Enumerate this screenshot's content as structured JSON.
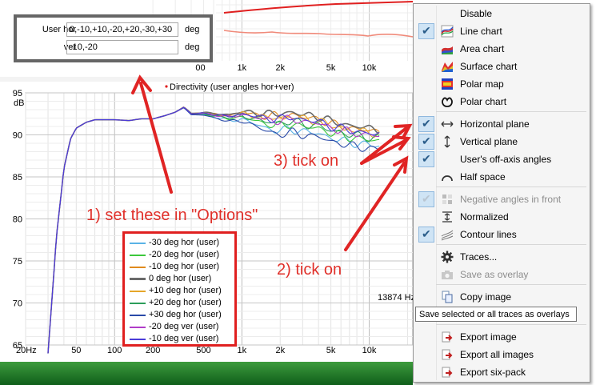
{
  "chart": {
    "title": "Directivity (user angles hor+ver)",
    "y_unit": "dB",
    "marker_readout": "13874 Hz"
  },
  "options_panel": {
    "rows": [
      {
        "label": "User hor",
        "value": "0,-10,+10,-20,+20,-30,+30",
        "unit": "deg"
      },
      {
        "label": "ver",
        "value": "-10,-20",
        "unit": "deg"
      }
    ]
  },
  "legend": [
    {
      "label": "-30 deg hor (user)",
      "color": "#5ab3e6"
    },
    {
      "label": "-20 deg hor (user)",
      "color": "#3cc83c"
    },
    {
      "label": "-10 deg hor (user)",
      "color": "#e08a1e"
    },
    {
      "label": "0 deg hor (user)",
      "color": "#6a6a6a"
    },
    {
      "label": "+10 deg hor (user)",
      "color": "#e6a62a"
    },
    {
      "label": "+20 deg hor (user)",
      "color": "#2c9e5a"
    },
    {
      "label": "+30 deg hor (user)",
      "color": "#2a4aa8"
    },
    {
      "label": "-20 deg ver (user)",
      "color": "#b03cc8"
    },
    {
      "label": "-10 deg ver (user)",
      "color": "#4a3cd8"
    }
  ],
  "menu": {
    "items": [
      {
        "label": "Disable",
        "checked": false,
        "icon": "blank-icon",
        "disabled": false
      },
      {
        "label": "Line chart",
        "checked": true,
        "icon": "line-chart-icon",
        "disabled": false
      },
      {
        "label": "Area chart",
        "checked": false,
        "icon": "area-chart-icon",
        "disabled": false
      },
      {
        "label": "Surface chart",
        "checked": false,
        "icon": "surface-chart-icon",
        "disabled": false
      },
      {
        "label": "Polar map",
        "checked": false,
        "icon": "polar-map-icon",
        "disabled": false
      },
      {
        "label": "Polar chart",
        "checked": false,
        "icon": "polar-chart-icon",
        "disabled": false
      },
      {
        "label": "Horizontal plane",
        "checked": true,
        "icon": "horizontal-arrows-icon",
        "disabled": false
      },
      {
        "label": "Vertical plane",
        "checked": true,
        "icon": "vertical-arrows-icon",
        "disabled": false
      },
      {
        "label": "User's off-axis angles",
        "checked": true,
        "icon": "blank-icon",
        "disabled": false
      },
      {
        "label": "Half space",
        "checked": false,
        "icon": "half-space-icon",
        "disabled": false
      },
      {
        "label": "Negative angles in front",
        "checked": true,
        "icon": "negative-angles-icon",
        "disabled": true
      },
      {
        "label": "Normalized",
        "checked": false,
        "icon": "normalized-icon",
        "disabled": false
      },
      {
        "label": "Contour lines",
        "checked": true,
        "icon": "contour-lines-icon",
        "disabled": false
      },
      {
        "label": "Traces...",
        "checked": false,
        "icon": "gear-icon",
        "disabled": false
      },
      {
        "label": "Save as overlay",
        "checked": false,
        "icon": "camera-icon",
        "disabled": true
      },
      {
        "label": "Copy image",
        "checked": false,
        "icon": "copy-icon",
        "disabled": false
      },
      {
        "label": "Export image",
        "checked": false,
        "icon": "export-icon",
        "disabled": false
      },
      {
        "label": "Export all images",
        "checked": false,
        "icon": "export-icon",
        "disabled": false
      },
      {
        "label": "Export six-pack",
        "checked": false,
        "icon": "export-icon",
        "disabled": false
      }
    ],
    "tooltip": "Save selected or all traces as overlays"
  },
  "annotations": {
    "step1": "1) set these in \"Options\"",
    "step2": "2) tick on",
    "step3": "3) tick on"
  },
  "chart_data": {
    "type": "line",
    "title": "Directivity (user angles hor+ver)",
    "ylabel": "dB",
    "xlabel": "",
    "x_scale": "log",
    "ylim": [
      65,
      95
    ],
    "y_ticks": [
      65,
      70,
      75,
      80,
      85,
      90,
      95
    ],
    "x_ticks": [
      {
        "v": 20,
        "label": "20Hz"
      },
      {
        "v": 50,
        "label": "50"
      },
      {
        "v": 100,
        "label": "100"
      },
      {
        "v": 200,
        "label": "200"
      },
      {
        "v": 500,
        "label": "500"
      },
      {
        "v": 1000,
        "label": "1k"
      },
      {
        "v": 2000,
        "label": "2k"
      },
      {
        "v": 5000,
        "label": "5k"
      },
      {
        "v": 10000,
        "label": "10k"
      }
    ],
    "top_panel_x_ticks": [
      {
        "v": 500,
        "label": "00"
      },
      {
        "v": 1000,
        "label": "1k"
      },
      {
        "v": 2000,
        "label": "2k"
      },
      {
        "v": 5000,
        "label": "5k"
      },
      {
        "v": 10000,
        "label": "10k"
      }
    ],
    "base_curve": {
      "x": [
        30,
        35,
        40,
        45,
        50,
        60,
        70,
        80,
        100,
        130,
        160,
        200,
        250,
        300,
        350,
        400,
        500,
        600,
        700,
        800,
        1000,
        1200,
        1500,
        2000,
        2500,
        3000,
        4000,
        5000,
        6000,
        7000,
        8000,
        10000,
        12000
      ],
      "y": [
        64,
        78,
        86,
        89.5,
        90.8,
        91.5,
        91.8,
        91.8,
        91.8,
        91.7,
        91.9,
        91.9,
        92.3,
        92.7,
        93.3,
        92.5,
        92.6,
        92.4,
        92.3,
        92.2,
        92.5,
        92.3,
        92.0,
        91.9,
        92.1,
        91.8,
        91.6,
        91.0,
        90.8,
        90.5,
        90.4,
        90.2,
        90.1
      ]
    },
    "series": [
      {
        "name": "-30 deg hor (user)",
        "color": "#5ab3e6",
        "offset": -1.4
      },
      {
        "name": "-20 deg hor (user)",
        "color": "#3cc83c",
        "offset": -0.8
      },
      {
        "name": "-10 deg hor (user)",
        "color": "#e08a1e",
        "offset": 0.3
      },
      {
        "name": "0 deg hor (user)",
        "color": "#6a6a6a",
        "offset": 0.6
      },
      {
        "name": "+10 deg hor (user)",
        "color": "#e6a62a",
        "offset": 0.1
      },
      {
        "name": "+20 deg hor (user)",
        "color": "#2c9e5a",
        "offset": -0.5
      },
      {
        "name": "+30 deg hor (user)",
        "color": "#2a4aa8",
        "offset": -1.8
      },
      {
        "name": "-20 deg ver (user)",
        "color": "#b03cc8",
        "offset": -0.2
      },
      {
        "name": "-10 deg ver (user)",
        "color": "#4a3cd8",
        "offset": 0.0
      }
    ]
  }
}
